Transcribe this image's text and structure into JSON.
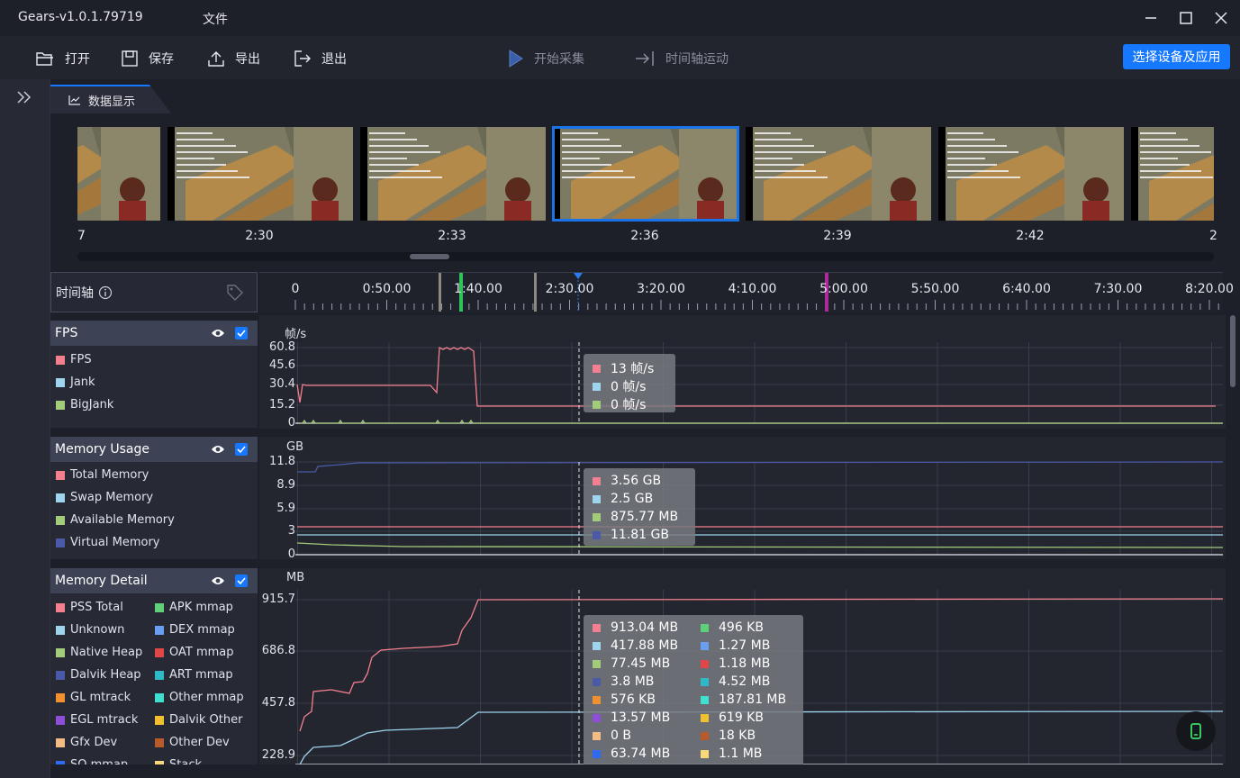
{
  "app": {
    "title": "Gears-v1.0.1.79719",
    "menu_file": "文件"
  },
  "toolbar": {
    "open": "打开",
    "save": "保存",
    "export": "导出",
    "exit": "退出",
    "start_capture": "开始采集",
    "timeline_move": "时间轴运动",
    "select_device": "选择设备及应用"
  },
  "tab": {
    "label": "数据显示"
  },
  "thumbnails": {
    "times": [
      "7",
      "2:30",
      "2:33",
      "2:36",
      "2:39",
      "2:42",
      "2"
    ],
    "selected_index": 3
  },
  "timeline": {
    "label": "时间轴",
    "ticks": [
      "0",
      "0:50.00",
      "1:40.00",
      "2:30.00",
      "3:20.00",
      "4:10.00",
      "5:00.00",
      "5:50.00",
      "6:40.00",
      "7:30.00",
      "8:20.00"
    ]
  },
  "fps_panel": {
    "title": "FPS",
    "unit": "帧/s",
    "legend": [
      {
        "name": "FPS",
        "color": "#f4808f"
      },
      {
        "name": "Jank",
        "color": "#9fd4ef"
      },
      {
        "name": "BigJank",
        "color": "#a3cc7a"
      }
    ],
    "yticks": [
      "60.8",
      "45.6",
      "30.4",
      "15.2",
      "0"
    ],
    "tooltip": [
      {
        "value": "13",
        "unit": "帧/s",
        "color": "#f4808f"
      },
      {
        "value": "0",
        "unit": "帧/s",
        "color": "#9fd4ef"
      },
      {
        "value": "0",
        "unit": "帧/s",
        "color": "#a3cc7a"
      }
    ]
  },
  "memory_usage_panel": {
    "title": "Memory Usage",
    "unit": "GB",
    "legend": [
      {
        "name": "Total Memory",
        "color": "#f4808f"
      },
      {
        "name": "Swap Memory",
        "color": "#9fd4ef"
      },
      {
        "name": "Available Memory",
        "color": "#a3cc7a"
      },
      {
        "name": "Virtual Memory",
        "color": "#4a5aa8"
      }
    ],
    "yticks": [
      "11.8",
      "8.9",
      "5.9",
      "3",
      "0"
    ],
    "tooltip": [
      {
        "value": "3.56",
        "unit": "GB",
        "color": "#f4808f"
      },
      {
        "value": "2.5",
        "unit": "GB",
        "color": "#9fd4ef"
      },
      {
        "value": "875.77",
        "unit": "MB",
        "color": "#a3cc7a"
      },
      {
        "value": "11.81",
        "unit": "GB",
        "color": "#4a5aa8"
      }
    ]
  },
  "memory_detail_panel": {
    "title": "Memory Detail",
    "unit": "MB",
    "legend_left": [
      {
        "name": "PSS Total",
        "color": "#f4808f"
      },
      {
        "name": "Unknown",
        "color": "#9fd4ef"
      },
      {
        "name": "Native Heap",
        "color": "#a3cc7a"
      },
      {
        "name": "Dalvik Heap",
        "color": "#4a5aa8"
      },
      {
        "name": "GL mtrack",
        "color": "#f0902f"
      },
      {
        "name": "EGL mtrack",
        "color": "#8c4fd6"
      },
      {
        "name": "Gfx Dev",
        "color": "#f2bc84"
      },
      {
        "name": "SO mmap",
        "color": "#2f6bf0"
      }
    ],
    "legend_right": [
      {
        "name": "APK mmap",
        "color": "#5fcf7a"
      },
      {
        "name": "DEX mmap",
        "color": "#6a9ef0"
      },
      {
        "name": "OAT mmap",
        "color": "#e04848"
      },
      {
        "name": "ART mmap",
        "color": "#2fb8c8"
      },
      {
        "name": "Other mmap",
        "color": "#40e0d0"
      },
      {
        "name": "Dalvik Other",
        "color": "#f0c030"
      },
      {
        "name": "Other Dev",
        "color": "#b85a2a"
      },
      {
        "name": "Stack",
        "color": "#f8d878"
      }
    ],
    "yticks": [
      "915.7",
      "686.8",
      "457.8",
      "228.9"
    ],
    "tooltip_left": [
      {
        "value": "913.04",
        "unit": "MB",
        "color": "#f4808f"
      },
      {
        "value": "417.88",
        "unit": "MB",
        "color": "#9fd4ef"
      },
      {
        "value": "77.45",
        "unit": "MB",
        "color": "#a3cc7a"
      },
      {
        "value": "3.8",
        "unit": "MB",
        "color": "#4a5aa8"
      },
      {
        "value": "576",
        "unit": "KB",
        "color": "#f0902f"
      },
      {
        "value": "13.57",
        "unit": "MB",
        "color": "#8c4fd6"
      },
      {
        "value": "0",
        "unit": "B",
        "color": "#f2bc84"
      },
      {
        "value": "63.74",
        "unit": "MB",
        "color": "#2f6bf0"
      }
    ],
    "tooltip_right": [
      {
        "value": "496",
        "unit": "KB",
        "color": "#5fcf7a"
      },
      {
        "value": "1.27",
        "unit": "MB",
        "color": "#6a9ef0"
      },
      {
        "value": "1.18",
        "unit": "MB",
        "color": "#e04848"
      },
      {
        "value": "4.52",
        "unit": "MB",
        "color": "#2fb8c8"
      },
      {
        "value": "187.81",
        "unit": "MB",
        "color": "#40e0d0"
      },
      {
        "value": "619",
        "unit": "KB",
        "color": "#f0c030"
      },
      {
        "value": "18",
        "unit": "KB",
        "color": "#b85a2a"
      },
      {
        "value": "1.1",
        "unit": "MB",
        "color": "#f8d878"
      }
    ]
  },
  "colors": {
    "accent": "#1677ff",
    "background": "#1e2029",
    "panel_header": "#3d4255"
  }
}
